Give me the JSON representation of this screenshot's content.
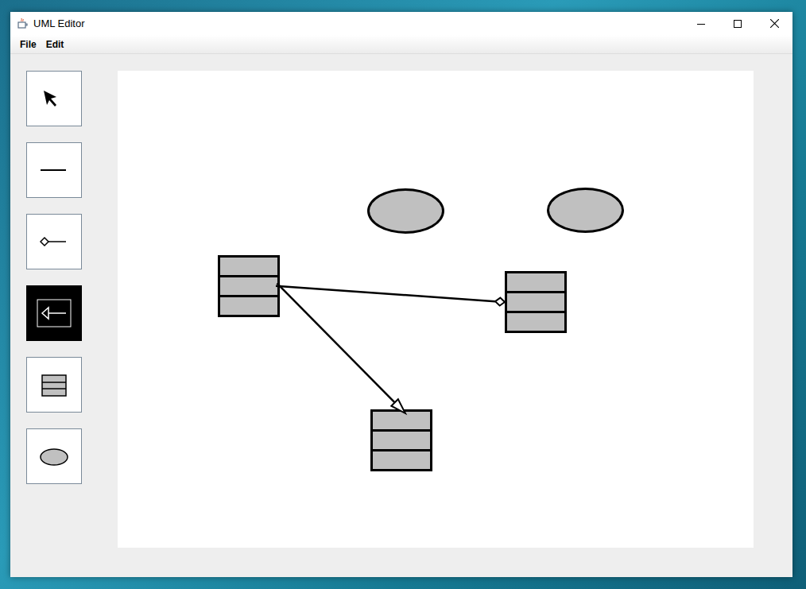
{
  "window": {
    "title": "UML Editor"
  },
  "menu": [
    {
      "label": "File"
    },
    {
      "label": "Edit"
    }
  ],
  "tools": [
    {
      "kind": "select",
      "selected": false
    },
    {
      "kind": "association",
      "selected": false
    },
    {
      "kind": "composition",
      "selected": false
    },
    {
      "kind": "generalization",
      "selected": true
    },
    {
      "kind": "class",
      "selected": false
    },
    {
      "kind": "usecase",
      "selected": false
    }
  ],
  "canvas": {
    "nodes": [
      {
        "kind": "usecase"
      },
      {
        "kind": "usecase"
      },
      {
        "kind": "class"
      },
      {
        "kind": "class"
      },
      {
        "kind": "class"
      }
    ],
    "links": [
      {
        "kind": "composition",
        "from": 2,
        "to": 3
      },
      {
        "kind": "generalization",
        "from": 2,
        "to": 4
      }
    ]
  }
}
